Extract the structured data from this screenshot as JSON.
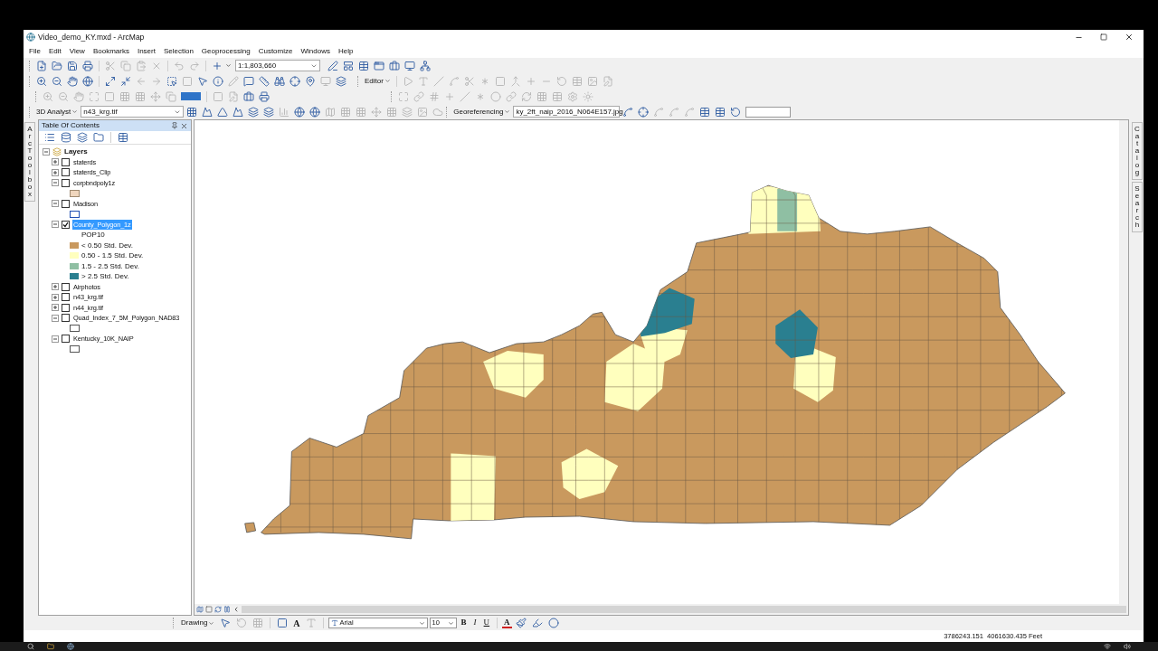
{
  "window": {
    "title": "Video_demo_KY.mxd - ArcMap"
  },
  "menu": [
    "File",
    "Edit",
    "View",
    "Bookmarks",
    "Insert",
    "Selection",
    "Geoprocessing",
    "Customize",
    "Windows",
    "Help"
  ],
  "toolbars": {
    "scale": "1:1,803,660",
    "editor": "Editor",
    "analyst": "3D Analyst",
    "analyst_layer": "n43_krg.tif",
    "georeferencing": "Georeferencing",
    "georef_layer": "ky_2ft_naip_2016_N064E157.jpg"
  },
  "left_tabs": [
    "ArcToolbox"
  ],
  "right_tabs": [
    "Catalog",
    "Search"
  ],
  "toc": {
    "title": "Table Of Contents",
    "root": "Layers",
    "layers": [
      {
        "name": "staterds",
        "checked": false,
        "expanded": false,
        "selected": false
      },
      {
        "name": "staterds_Clip",
        "checked": false,
        "expanded": false,
        "selected": false
      },
      {
        "name": "corpbndpoly1z",
        "checked": false,
        "expanded": true,
        "selected": false,
        "symbol": {
          "kind": "fill",
          "color": "#f0d6bd"
        }
      },
      {
        "name": "Madison",
        "checked": false,
        "expanded": true,
        "selected": false,
        "symbol": {
          "kind": "outline",
          "color": "#1f4fb4"
        }
      },
      {
        "name": "County_Polygon_1z",
        "checked": true,
        "expanded": true,
        "selected": true,
        "field": "POP10",
        "classes": [
          {
            "label": "< 0.50 Std. Dev.",
            "color": "#c9995e"
          },
          {
            "label": "0.50 - 1.5 Std. Dev.",
            "color": "#ffffbe"
          },
          {
            "label": "1.5 - 2.5 Std. Dev.",
            "color": "#8fbfa3"
          },
          {
            "label": "> 2.5 Std. Dev.",
            "color": "#2a7f90"
          }
        ]
      },
      {
        "name": "Airphotos",
        "checked": false,
        "expanded": false,
        "selected": false
      },
      {
        "name": "n43_krg.tif",
        "checked": false,
        "expanded": false,
        "selected": false
      },
      {
        "name": "n44_krg.tif",
        "checked": false,
        "expanded": false,
        "selected": false
      },
      {
        "name": "Quad_Index_7_5M_Polygon_NAD83",
        "checked": false,
        "expanded": true,
        "selected": false,
        "symbol": {
          "kind": "outline",
          "color": "#555555"
        }
      },
      {
        "name": "Kentucky_10K_NAIP",
        "checked": false,
        "expanded": true,
        "selected": false,
        "symbol": {
          "kind": "outline",
          "color": "#555555"
        }
      }
    ]
  },
  "drawing_toolbar": {
    "label": "Drawing",
    "text_tool": "A",
    "font": "Arial",
    "size": "10",
    "bold": "B",
    "italic": "I",
    "underline": "U",
    "font_color": "A"
  },
  "status_bar": {
    "coordinates": "3786243.151  4061630.435 Feet"
  }
}
